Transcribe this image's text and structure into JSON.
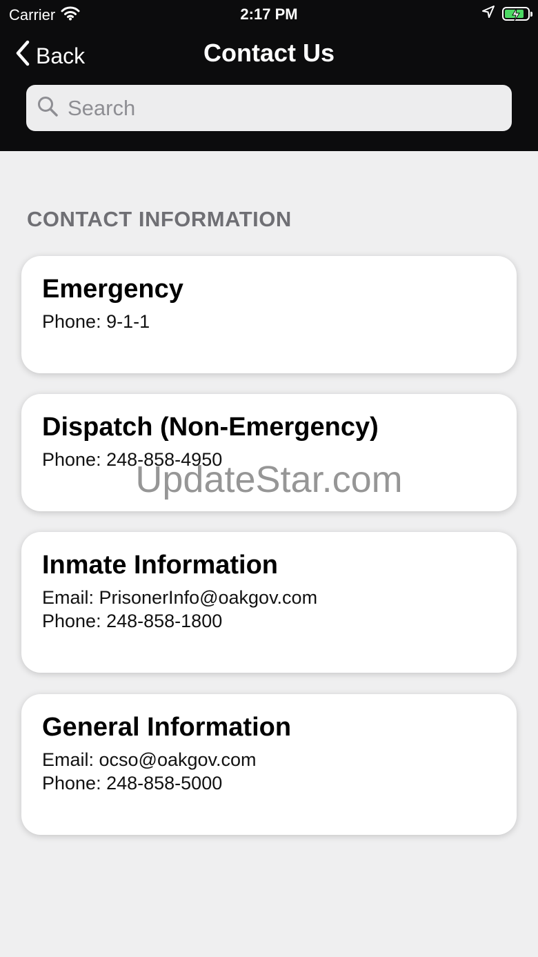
{
  "status_bar": {
    "carrier": "Carrier",
    "time": "2:17 PM",
    "battery_level": 0.85,
    "icons": [
      "wifi-icon",
      "location-arrow-icon",
      "battery-charging-icon"
    ]
  },
  "nav": {
    "back_label": "Back",
    "title": "Contact Us"
  },
  "search": {
    "placeholder": "Search",
    "value": ""
  },
  "section": {
    "header": "CONTACT INFORMATION"
  },
  "cards": [
    {
      "title": "Emergency",
      "lines": [
        "Phone: 9-1-1"
      ]
    },
    {
      "title": "Dispatch (Non-Emergency)",
      "lines": [
        "Phone: 248-858-4950"
      ]
    },
    {
      "title": "Inmate Information",
      "lines": [
        "Email: PrisonerInfo@oakgov.com",
        "Phone: 248-858-1800"
      ]
    },
    {
      "title": "General Information",
      "lines": [
        "Email: ocso@oakgov.com",
        "Phone: 248-858-5000"
      ]
    }
  ],
  "watermark": "UpdateStar.com",
  "colors": {
    "header_bg": "#0c0c0d",
    "page_bg": "#efeff0",
    "card_bg": "#ffffff",
    "section_header": "#6f6f74",
    "battery_fill": "#4cd964"
  }
}
